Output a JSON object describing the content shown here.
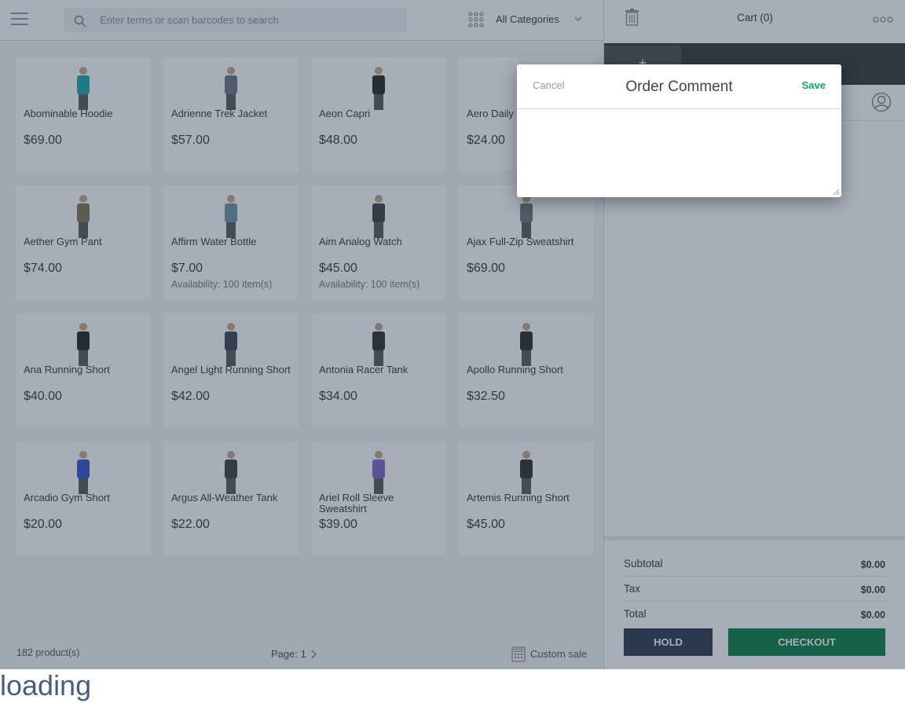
{
  "header": {
    "search_placeholder": "Enter terms or scan barcodes to search",
    "category_label": "All Categories"
  },
  "catalog": {
    "products": [
      {
        "name": "Abominable Hoodie",
        "price": "$69.00",
        "availability": "",
        "color": "#1aa3a8"
      },
      {
        "name": "Adrienne Trek Jacket",
        "price": "$57.00",
        "availability": "",
        "color": "#6b6f86"
      },
      {
        "name": "Aeon Capri",
        "price": "$48.00",
        "availability": "",
        "color": "#222222"
      },
      {
        "name": "Aero Daily Fitness Tee",
        "price": "$24.00",
        "availability": "",
        "color": "#8a8f98"
      },
      {
        "name": "Aether Gym Pant",
        "price": "$74.00",
        "availability": "",
        "color": "#7a7350"
      },
      {
        "name": "Affirm Water Bottle",
        "price": "$7.00",
        "availability": "Availability: 100 item(s)",
        "color": "#6e8fa8"
      },
      {
        "name": "Aim Analog Watch",
        "price": "$45.00",
        "availability": "Availability: 100 item(s)",
        "color": "#3c3c3c"
      },
      {
        "name": "Ajax Full-Zip Sweatshirt",
        "price": "$69.00",
        "availability": "",
        "color": "#6d7175"
      },
      {
        "name": "Ana Running Short",
        "price": "$40.00",
        "availability": "",
        "color": "#1e1e1e"
      },
      {
        "name": "Angel Light Running Short",
        "price": "$42.00",
        "availability": "",
        "color": "#3d4150"
      },
      {
        "name": "Antonia Racer Tank",
        "price": "$34.00",
        "availability": "",
        "color": "#2a2a2a"
      },
      {
        "name": "Apollo Running Short",
        "price": "$32.50",
        "availability": "",
        "color": "#262626"
      },
      {
        "name": "Arcadio Gym Short",
        "price": "$20.00",
        "availability": "",
        "color": "#2f4fc9"
      },
      {
        "name": "Argus All-Weather Tank",
        "price": "$22.00",
        "availability": "",
        "color": "#3a3a3a"
      },
      {
        "name": "Ariel Roll Sleeve Sweatshirt",
        "price": "$39.00",
        "availability": "",
        "color": "#7a63c9"
      },
      {
        "name": "Artemis Running Short",
        "price": "$45.00",
        "availability": "",
        "color": "#2a2a2a"
      }
    ],
    "product_count": "182 product(s)",
    "page_label": "Page: 1",
    "custom_sale_label": "Custom sale"
  },
  "cart": {
    "title": "Cart (0)",
    "tab_plus": "+",
    "subtotal_label": "Subtotal",
    "subtotal_value": "$0.00",
    "tax_label": "Tax",
    "tax_value": "$0.00",
    "total_label": "Total",
    "total_value": "$0.00",
    "hold_label": "HOLD",
    "checkout_label": "CHECKOUT"
  },
  "modal": {
    "cancel_label": "Cancel",
    "title": "Order Comment",
    "save_label": "Save",
    "comment_value": ""
  },
  "status": {
    "loading_text": "loading"
  }
}
